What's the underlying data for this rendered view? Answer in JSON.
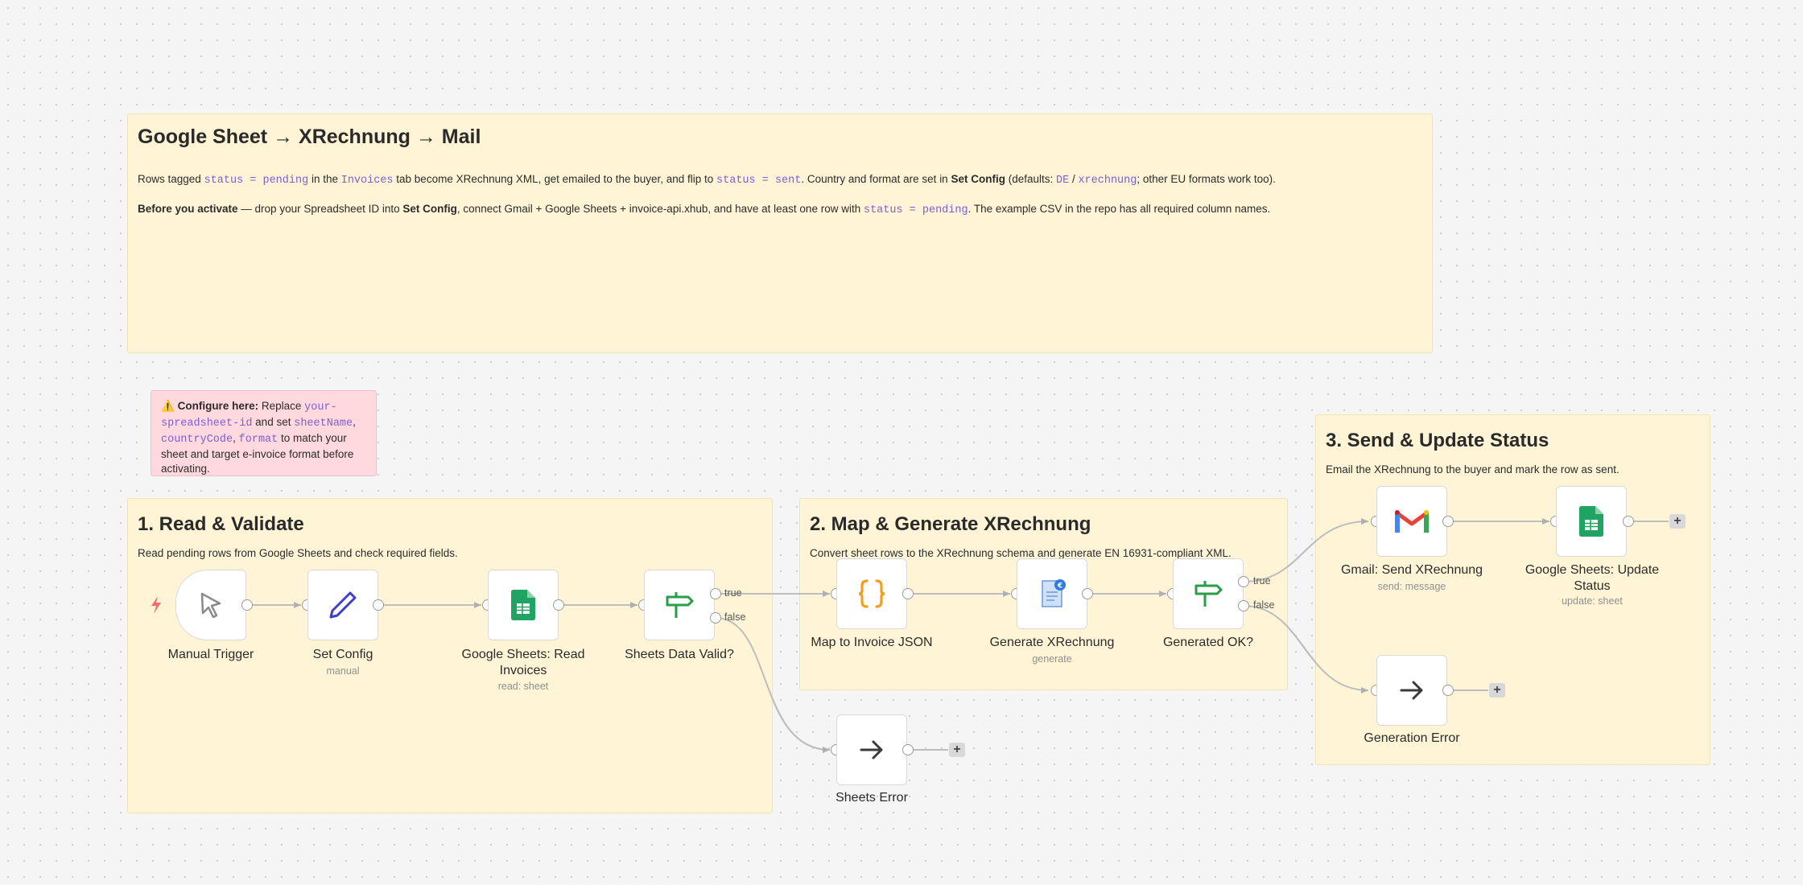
{
  "title_note": {
    "heading": "Google Sheet → XRechnung → Mail",
    "p1": {
      "t1": "Rows tagged ",
      "c1": "status = pending",
      "t2": " in the ",
      "c2": "Invoices",
      "t3": " tab become XRechnung XML, get emailed to the buyer, and flip to ",
      "c3": "status = sent",
      "t4": ". Country and format are set in ",
      "b1": "Set Config",
      "t5": " (defaults: ",
      "c4": "DE",
      "t6": " / ",
      "c5": "xrechnung",
      "t7": "; other EU formats work too)."
    },
    "p2": {
      "b1": "Before you activate",
      "t1": " — drop your Spreadsheet ID into ",
      "b2": "Set Config",
      "t2": ", connect Gmail + Google Sheets + invoice-api.xhub, and have at least one row with ",
      "c1": "status = pending",
      "t3": ". The example CSV in the repo has all required column names."
    }
  },
  "config_note": {
    "icon": "⚠️",
    "bold": "Configure here:",
    "t1": " Replace ",
    "c1": "your-spreadsheet-id",
    "t2": " and set ",
    "c2": "sheetName",
    "t3": ", ",
    "c3": "countryCode",
    "t4": ", ",
    "c4": "format",
    "t5": " to match your sheet and target e-invoice format before activating."
  },
  "sections": {
    "s1": {
      "heading": "1. Read & Validate",
      "desc": "Read pending rows from Google Sheets and check required fields."
    },
    "s2": {
      "heading": "2. Map & Generate XRechnung",
      "desc": "Convert sheet rows to the XRechnung schema and generate EN 16931-compliant XML."
    },
    "s3": {
      "heading": "3. Send & Update Status",
      "desc": "Email the XRechnung to the buyer and mark the row as sent."
    }
  },
  "nodes": {
    "manual_trigger": {
      "label": "Manual Trigger",
      "icon": "cursor-icon"
    },
    "set_config": {
      "label": "Set Config",
      "sub": "manual",
      "icon": "pencil-icon"
    },
    "read_invoices": {
      "label": "Google Sheets: Read Invoices",
      "sub": "read: sheet",
      "icon": "google-sheets-icon"
    },
    "sheets_valid": {
      "label": "Sheets Data Valid?",
      "icon": "signpost-icon"
    },
    "map_json": {
      "label": "Map to Invoice JSON",
      "icon": "braces-icon"
    },
    "generate": {
      "label": "Generate XRechnung",
      "sub": "generate",
      "icon": "invoice-doc-icon"
    },
    "generated_ok": {
      "label": "Generated OK?",
      "icon": "signpost-icon"
    },
    "sheets_error": {
      "label": "Sheets Error",
      "icon": "arrow-right-icon"
    },
    "gmail_send": {
      "label": "Gmail: Send XRechnung",
      "sub": "send: message",
      "icon": "gmail-icon"
    },
    "update_status": {
      "label": "Google Sheets: Update Status",
      "sub": "update: sheet",
      "icon": "google-sheets-icon"
    },
    "generation_error": {
      "label": "Generation Error",
      "icon": "arrow-right-icon"
    }
  },
  "branches": {
    "true": "true",
    "false": "false"
  },
  "add_symbol": "+",
  "colors": {
    "sticky_bg": "#fff5d6",
    "warning_bg": "#ffd9dd",
    "code": "#7b5fd1",
    "sheets_green": "#1fa463",
    "if_green": "#2a9d48",
    "braces_orange": "#f0a020",
    "pencil_blue": "#3f3fc9",
    "trigger_bolt": "#f36b6b"
  }
}
